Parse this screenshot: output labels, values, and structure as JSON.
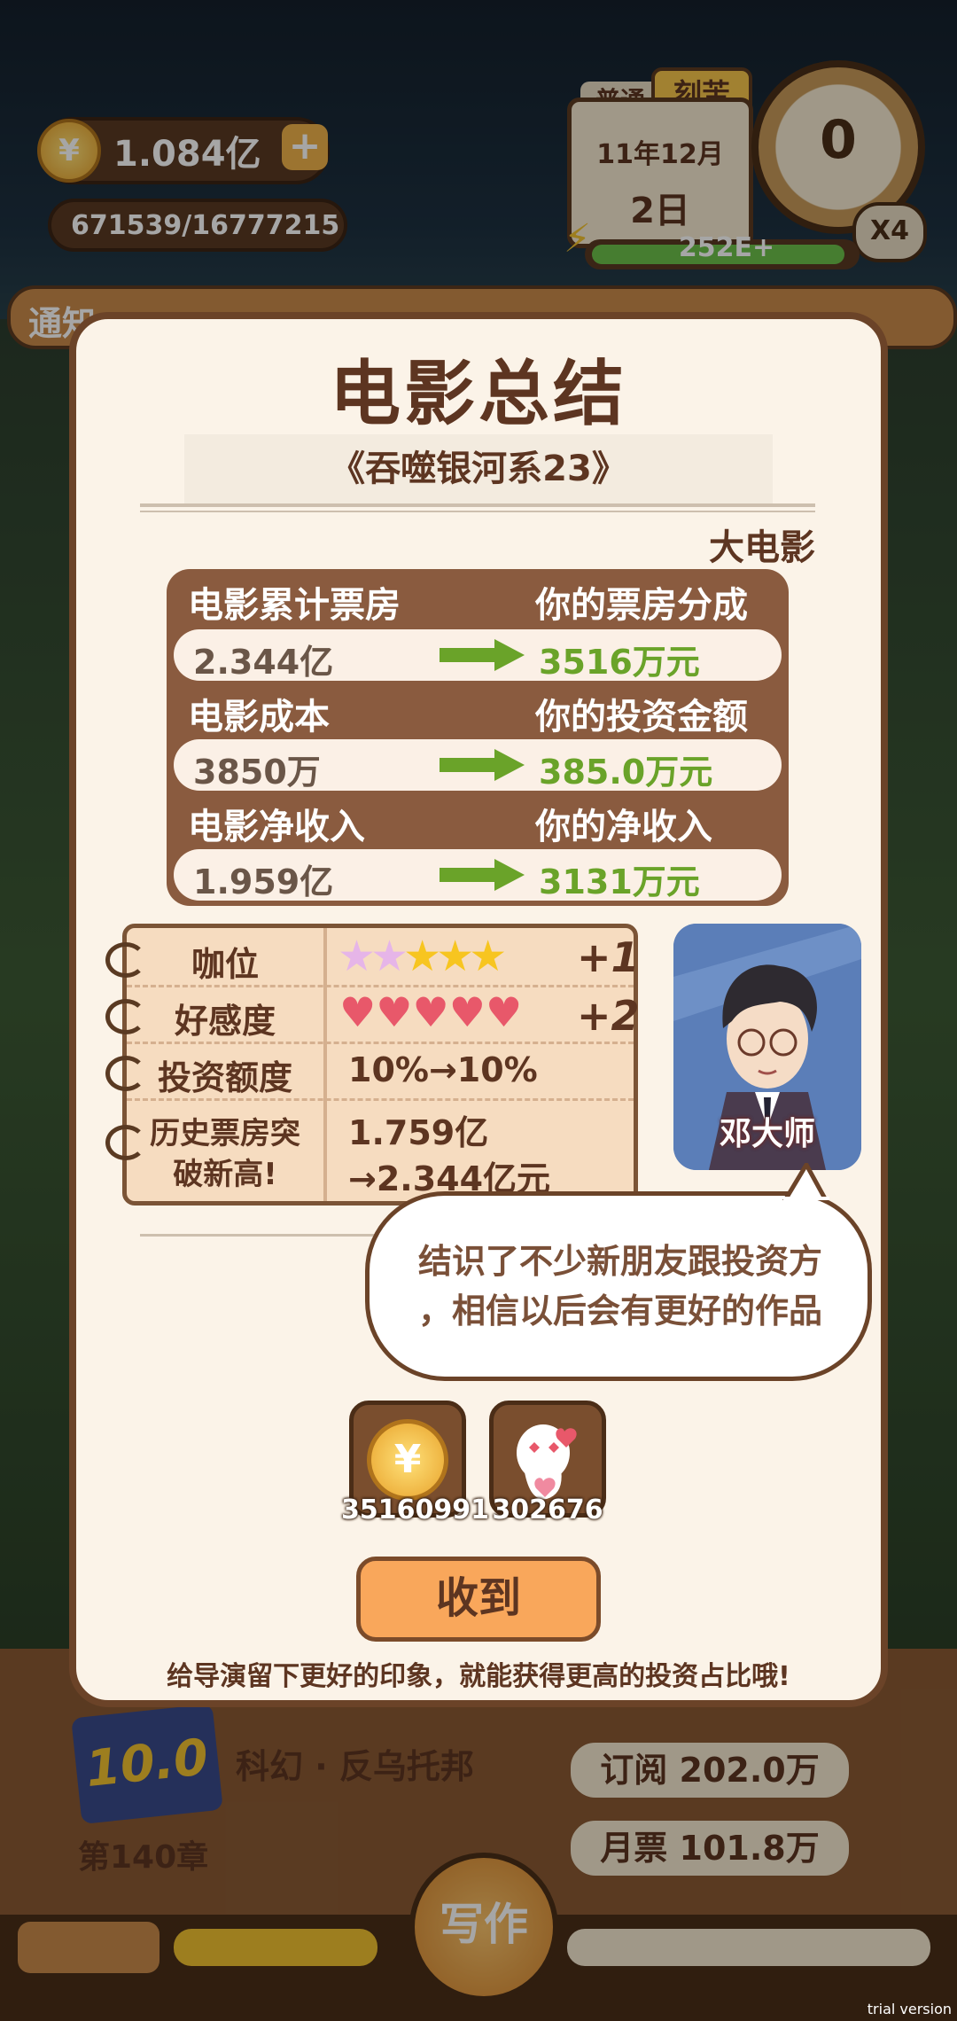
{
  "hud": {
    "money": "1.084亿",
    "exp": "671539/16777215",
    "mode_tabs": [
      "普通",
      "刻苦"
    ],
    "year_month": "11年12月",
    "day": "2日",
    "dial_value": "0",
    "energy": "252E+",
    "speed": "X4",
    "notice_label": "通知"
  },
  "background": {
    "genre": "科幻 · 反乌托邦",
    "rating": "10.0",
    "chapter": "第140章",
    "subscriptions": "订阅 202.0万",
    "monthly_votes": "月票 101.8万",
    "write_button": "写作"
  },
  "modal": {
    "title": "电影总结",
    "movie_name": "《吞噬银河系23》",
    "category": "大电影",
    "stats": [
      {
        "left_label": "电影累计票房",
        "right_label": "你的票房分成",
        "left_value": "2.344亿",
        "right_value": "3516万元"
      },
      {
        "left_label": "电影成本",
        "right_label": "你的投资金额",
        "left_value": "3850万",
        "right_value": "385.0万元"
      },
      {
        "left_label": "电影净收入",
        "right_label": "你的净收入",
        "left_value": "1.959亿",
        "right_value": "3131万元"
      }
    ],
    "notebook": {
      "rank_label": "咖位",
      "rank_delta": "+1",
      "affinity_label": "好感度",
      "affinity_delta": "+2",
      "invest_label": "投资额度",
      "invest_value": "10%→10%",
      "record_label_1": "历史票房突",
      "record_label_2": "破新高!",
      "record_value_1": "1.759亿",
      "record_value_2": "→2.344亿元"
    },
    "rank_stars": 5,
    "affinity_hearts": 5,
    "portrait_name": "邓大师",
    "speech_line_1": "结识了不少新朋友跟投资方",
    "speech_line_2": "，相信以后会有更好的作品",
    "rewards": [
      {
        "icon": "coin-icon",
        "count": "35160991"
      },
      {
        "icon": "heart-ghost-icon",
        "count": "302676"
      }
    ],
    "confirm_button": "收到",
    "hint": "给导演留下更好的印象，就能获得更高的投资占比哦!"
  },
  "watermark": "trial version",
  "colors": {
    "accent": "#f9a75b",
    "brown": "#5d3521",
    "green": "#6aa329",
    "board": "#8a5b3f"
  }
}
